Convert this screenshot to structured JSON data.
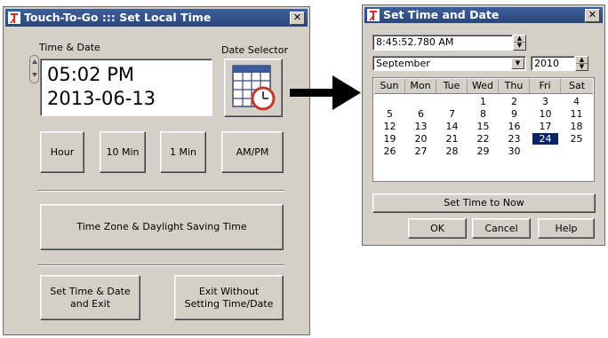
{
  "left_window": {
    "title": "Touch-To-Go ::: Set Local Time",
    "close_glyph": "✕",
    "time_date_label": "Time & Date",
    "date_selector_label": "Date Selector",
    "time_value": "05:02 PM",
    "date_value": "2013-06-13",
    "buttons": {
      "hour": "Hour",
      "ten_min": "10 Min",
      "one_min": "1 Min",
      "ampm": "AM/PM",
      "timezone": "Time Zone & Daylight Saving Time",
      "set_exit_line1": "Set Time & Date",
      "set_exit_line2": "and Exit",
      "exit_line1": "Exit Without",
      "exit_line2": "Setting Time/Date"
    }
  },
  "right_window": {
    "title": "Set Time and Date",
    "close_glyph": "✕",
    "time_value": "8:45:52.780 AM",
    "month_value": "September",
    "year_value": "2010",
    "weekdays": [
      "Sun",
      "Mon",
      "Tue",
      "Wed",
      "Thu",
      "Fri",
      "Sat"
    ],
    "weeks": [
      [
        "",
        "",
        "",
        "1",
        "2",
        "3",
        "4"
      ],
      [
        "5",
        "6",
        "7",
        "8",
        "9",
        "10",
        "11"
      ],
      [
        "12",
        "13",
        "14",
        "15",
        "16",
        "17",
        "18"
      ],
      [
        "19",
        "20",
        "21",
        "22",
        "23",
        "24",
        "25"
      ],
      [
        "26",
        "27",
        "28",
        "29",
        "30",
        "",
        ""
      ]
    ],
    "selected_day": "24",
    "set_now_label": "Set Time to Now",
    "ok_label": "OK",
    "cancel_label": "Cancel",
    "help_label": "Help"
  },
  "colors": {
    "titlebar": "#2f5188",
    "dialog_bg": "#d4d0c8",
    "selected_day_bg": "#0a246a",
    "arrow": "#000000",
    "clock_red": "#c0392b"
  }
}
